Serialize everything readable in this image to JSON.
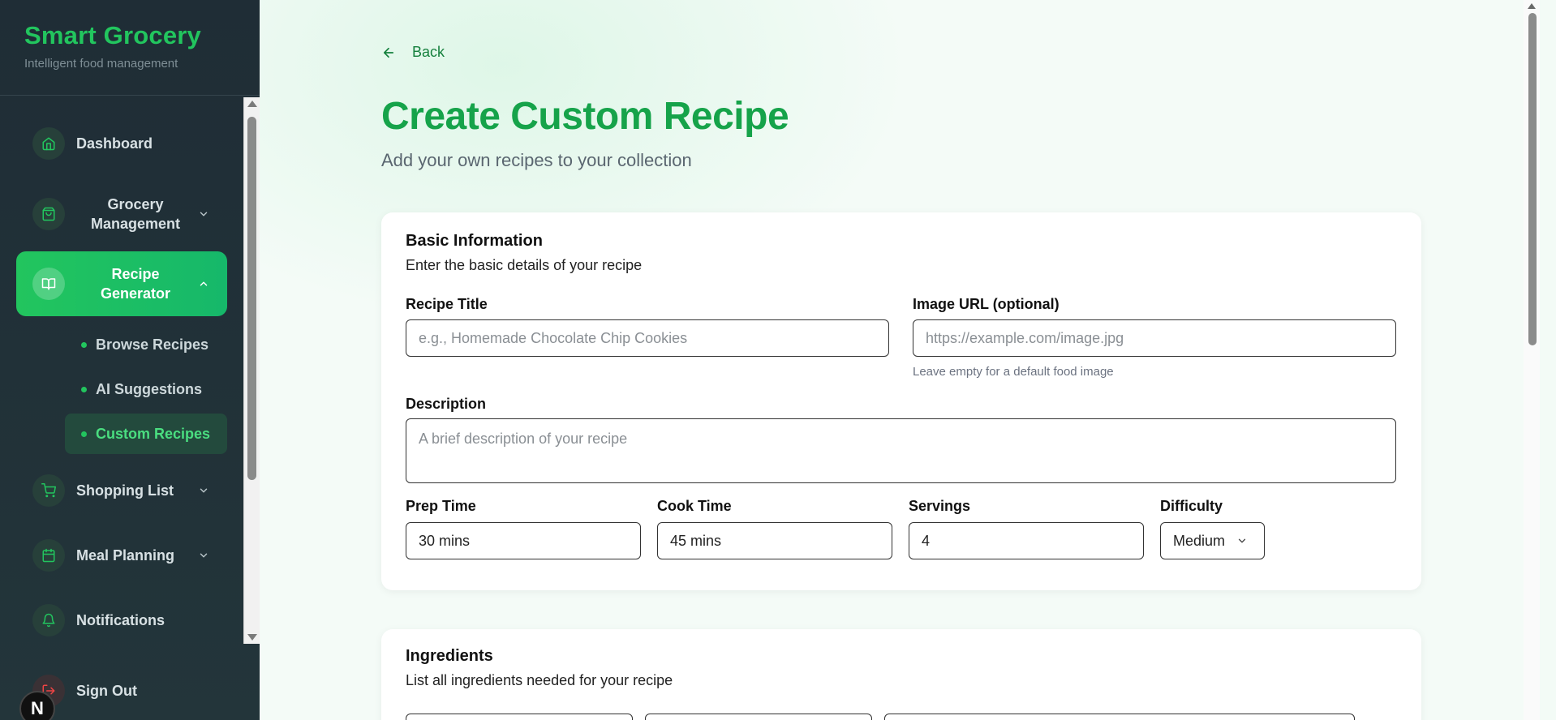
{
  "sidebar": {
    "brand_title": "Smart Grocery",
    "brand_subtitle": "Intelligent food management",
    "items": [
      {
        "label": "Dashboard"
      },
      {
        "label": "Grocery Management"
      },
      {
        "label": "Recipe Generator"
      },
      {
        "label": "Shopping List"
      },
      {
        "label": "Meal Planning"
      },
      {
        "label": "Notifications"
      }
    ],
    "sub_items": [
      {
        "label": "Browse Recipes"
      },
      {
        "label": "AI Suggestions"
      },
      {
        "label": "Custom Recipes"
      }
    ],
    "sign_out": "Sign Out",
    "badge": "N"
  },
  "main": {
    "back_label": "Back",
    "title": "Create Custom Recipe",
    "subtitle": "Add your own recipes to your collection",
    "basic": {
      "title": "Basic Information",
      "description": "Enter the basic details of your recipe",
      "recipe_title_label": "Recipe Title",
      "recipe_title_placeholder": "e.g., Homemade Chocolate Chip Cookies",
      "image_url_label": "Image URL (optional)",
      "image_url_placeholder": "https://example.com/image.jpg",
      "image_url_hint": "Leave empty for a default food image",
      "description_label": "Description",
      "description_placeholder": "A brief description of your recipe",
      "prep_label": "Prep Time",
      "prep_value": "30 mins",
      "cook_label": "Cook Time",
      "cook_value": "45 mins",
      "servings_label": "Servings",
      "servings_value": "4",
      "difficulty_label": "Difficulty",
      "difficulty_value": "Medium"
    },
    "ingredients": {
      "title": "Ingredients",
      "description": "List all ingredients needed for your recipe"
    }
  },
  "colors": {
    "accent": "#22c55e",
    "title_green": "#16a34a",
    "sidebar_bg": "#1f2d36"
  }
}
